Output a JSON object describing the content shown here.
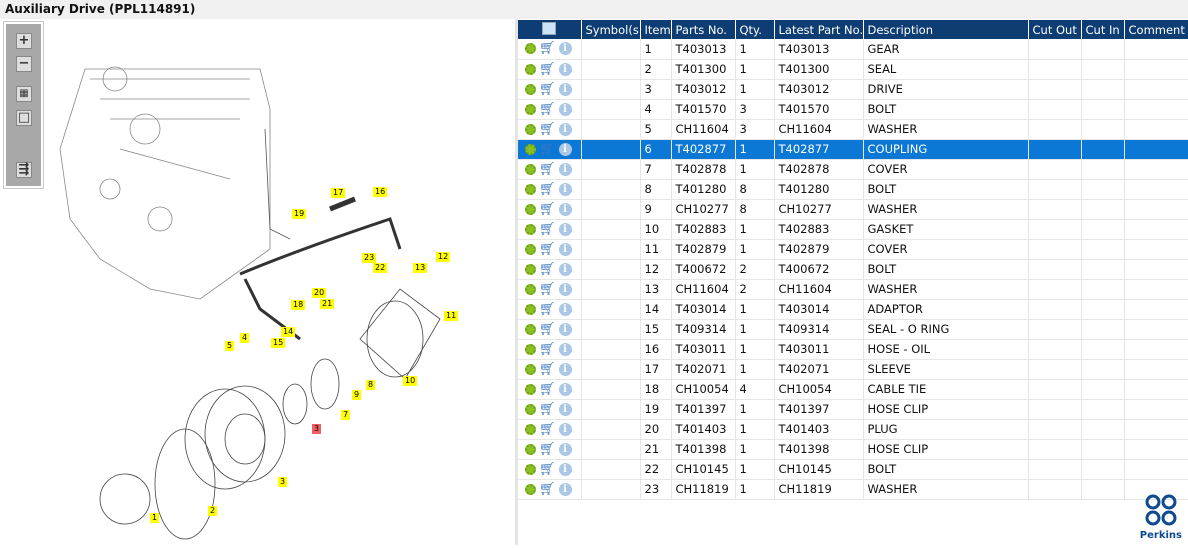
{
  "title": "Auxiliary Drive (PPL114891)",
  "toolbar": {
    "zoom_in": "+",
    "zoom_out": "−",
    "fit": "▦",
    "actual": "□",
    "layout": "⇶"
  },
  "columns": [
    "",
    "Symbol(s)",
    "Item",
    "Parts No.",
    "Qty.",
    "Latest Part No.",
    "Description",
    "Cut Out",
    "Cut In",
    "Comment"
  ],
  "selected_item": "6",
  "rows": [
    {
      "item": "1",
      "part": "T403013",
      "qty": "1",
      "latest": "T403013",
      "desc": "GEAR"
    },
    {
      "item": "2",
      "part": "T401300",
      "qty": "1",
      "latest": "T401300",
      "desc": "SEAL"
    },
    {
      "item": "3",
      "part": "T403012",
      "qty": "1",
      "latest": "T403012",
      "desc": "DRIVE"
    },
    {
      "item": "4",
      "part": "T401570",
      "qty": "3",
      "latest": "T401570",
      "desc": "BOLT"
    },
    {
      "item": "5",
      "part": "CH11604",
      "qty": "3",
      "latest": "CH11604",
      "desc": "WASHER"
    },
    {
      "item": "6",
      "part": "T402877",
      "qty": "1",
      "latest": "T402877",
      "desc": "COUPLING"
    },
    {
      "item": "7",
      "part": "T402878",
      "qty": "1",
      "latest": "T402878",
      "desc": "COVER"
    },
    {
      "item": "8",
      "part": "T401280",
      "qty": "8",
      "latest": "T401280",
      "desc": "BOLT"
    },
    {
      "item": "9",
      "part": "CH10277",
      "qty": "8",
      "latest": "CH10277",
      "desc": "WASHER"
    },
    {
      "item": "10",
      "part": "T402883",
      "qty": "1",
      "latest": "T402883",
      "desc": "GASKET"
    },
    {
      "item": "11",
      "part": "T402879",
      "qty": "1",
      "latest": "T402879",
      "desc": "COVER"
    },
    {
      "item": "12",
      "part": "T400672",
      "qty": "2",
      "latest": "T400672",
      "desc": "BOLT"
    },
    {
      "item": "13",
      "part": "CH11604",
      "qty": "2",
      "latest": "CH11604",
      "desc": "WASHER"
    },
    {
      "item": "14",
      "part": "T403014",
      "qty": "1",
      "latest": "T403014",
      "desc": "ADAPTOR"
    },
    {
      "item": "15",
      "part": "T409314",
      "qty": "1",
      "latest": "T409314",
      "desc": "SEAL - O RING"
    },
    {
      "item": "16",
      "part": "T403011",
      "qty": "1",
      "latest": "T403011",
      "desc": "HOSE - OIL"
    },
    {
      "item": "17",
      "part": "T402071",
      "qty": "1",
      "latest": "T402071",
      "desc": "SLEEVE"
    },
    {
      "item": "18",
      "part": "CH10054",
      "qty": "4",
      "latest": "CH10054",
      "desc": "CABLE TIE"
    },
    {
      "item": "19",
      "part": "T401397",
      "qty": "1",
      "latest": "T401397",
      "desc": "HOSE CLIP"
    },
    {
      "item": "20",
      "part": "T401403",
      "qty": "1",
      "latest": "T401403",
      "desc": "PLUG"
    },
    {
      "item": "21",
      "part": "T401398",
      "qty": "1",
      "latest": "T401398",
      "desc": "HOSE CLIP"
    },
    {
      "item": "22",
      "part": "CH10145",
      "qty": "1",
      "latest": "CH10145",
      "desc": "BOLT"
    },
    {
      "item": "23",
      "part": "CH11819",
      "qty": "1",
      "latest": "CH11819",
      "desc": "WASHER"
    }
  ],
  "callouts": [
    "1",
    "2",
    "3",
    "3",
    "4",
    "5",
    "7",
    "8",
    "9",
    "10",
    "11",
    "12",
    "13",
    "14",
    "15",
    "16",
    "17",
    "18",
    "19",
    "20",
    "21",
    "22",
    "23"
  ],
  "logo": "Perkins",
  "colors": {
    "header": "#0d3d72",
    "selected": "#0a78d4",
    "callout": "#ffff00"
  }
}
